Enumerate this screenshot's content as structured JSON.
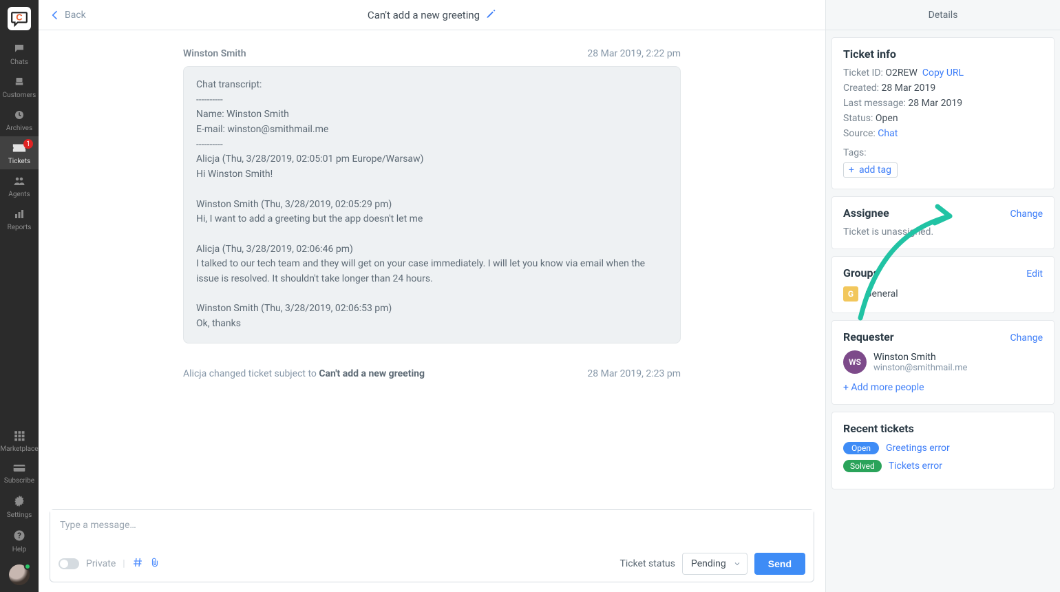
{
  "sidebar": {
    "items": [
      {
        "label": "Chats"
      },
      {
        "label": "Customers"
      },
      {
        "label": "Archives"
      },
      {
        "label": "Tickets",
        "badge": "1"
      },
      {
        "label": "Agents"
      },
      {
        "label": "Reports"
      }
    ],
    "bottom": [
      {
        "label": "Marketplace"
      },
      {
        "label": "Subscribe"
      },
      {
        "label": "Settings"
      },
      {
        "label": "Help"
      }
    ]
  },
  "topbar": {
    "back": "Back",
    "title": "Can't add a new greeting"
  },
  "message": {
    "author": "Winston Smith",
    "timestamp": "28 Mar 2019, 2:22 pm",
    "transcript": "Chat transcript:\n----------\nName: Winston Smith\nE-mail: winston@smithmail.me\n----------\nAlicja (Thu, 3/28/2019, 02:05:01 pm Europe/Warsaw)\nHi Winston Smith!\n\nWinston Smith (Thu, 3/28/2019, 02:05:29 pm)\nHi, I want to add a greeting but the app doesn't let me\n\nAlicja (Thu, 3/28/2019, 02:06:46 pm)\nI talked to our tech team and they will get on your case immediately. I will let you know via email when the issue is resolved. It shouldn't take longer than 24 hours.\n\nWinston Smith (Thu, 3/28/2019, 02:06:53 pm)\nOk, thanks"
  },
  "system_event": {
    "prefix": "Alicja changed ticket subject to ",
    "subject": "Can't add a new greeting",
    "timestamp": "28 Mar 2019, 2:23 pm"
  },
  "compose": {
    "placeholder": "Type a message…",
    "private": "Private",
    "status_label": "Ticket status",
    "status_value": "Pending",
    "send": "Send"
  },
  "details": {
    "header": "Details",
    "ticket_info": {
      "title": "Ticket info",
      "id_label": "Ticket ID:",
      "id_value": "O2REW",
      "copy": "Copy URL",
      "created_label": "Created:",
      "created_value": "28 Mar 2019",
      "last_label": "Last message:",
      "last_value": "28 Mar 2019",
      "status_label": "Status:",
      "status_value": "Open",
      "source_label": "Source:",
      "source_value": "Chat",
      "tags_label": "Tags:",
      "add_tag": "add tag"
    },
    "assignee": {
      "title": "Assignee",
      "change": "Change",
      "text": "Ticket is unassigned."
    },
    "groups": {
      "title": "Groups",
      "edit": "Edit",
      "badge": "G",
      "name": "General"
    },
    "requester": {
      "title": "Requester",
      "change": "Change",
      "initials": "WS",
      "name": "Winston Smith",
      "email": "winston@smithmail.me",
      "add": "+ Add more people"
    },
    "recent": {
      "title": "Recent tickets",
      "items": [
        {
          "status": "Open",
          "class": "open",
          "name": "Greetings error"
        },
        {
          "status": "Solved",
          "class": "solved",
          "name": "Tickets error"
        }
      ]
    }
  }
}
